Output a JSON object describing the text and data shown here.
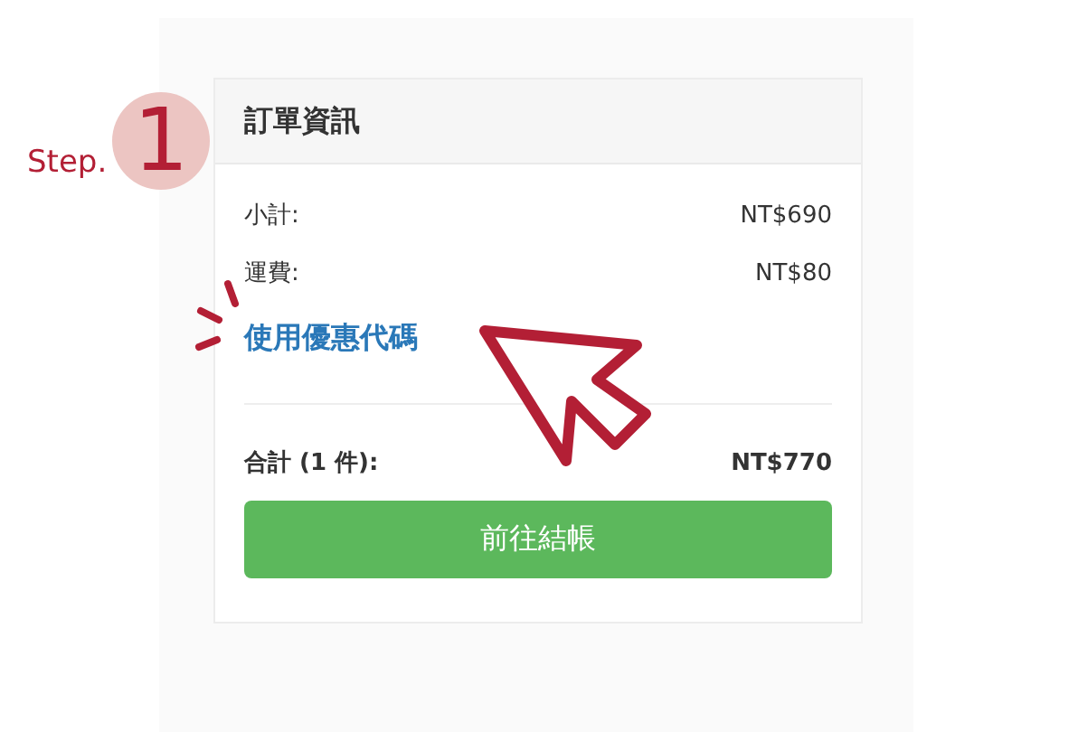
{
  "annotation": {
    "step_label": "Step.",
    "step_number": "1"
  },
  "card": {
    "title": "訂單資訊",
    "rows": [
      {
        "label": "小計:",
        "value": "NT$690"
      },
      {
        "label": "運費:",
        "value": "NT$80"
      }
    ],
    "coupon_link": "使用優惠代碼",
    "total": {
      "label": "合計 (1 件):",
      "value": "NT$770"
    },
    "checkout_button": "前往結帳"
  }
}
